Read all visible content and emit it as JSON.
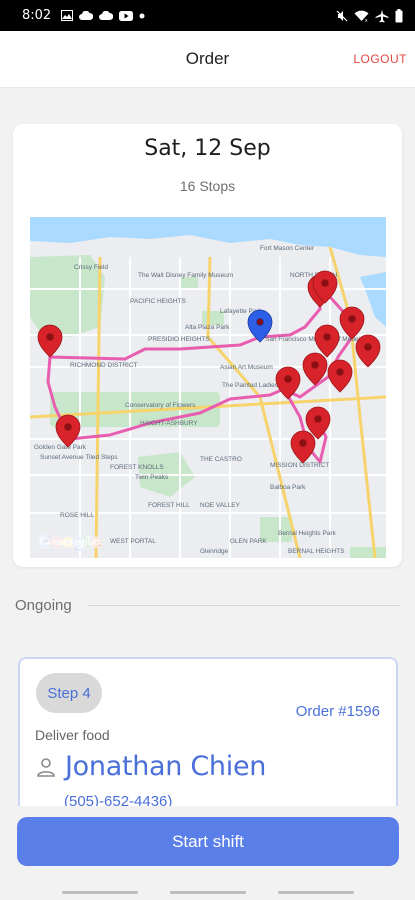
{
  "status_bar": {
    "time": "8:02",
    "left_icons": [
      "image-icon",
      "cloud-icon",
      "cloud-icon",
      "youtube-icon",
      "dot-icon"
    ],
    "right_icons": [
      "mute-icon",
      "wifi-icon",
      "airplane-icon",
      "battery-icon"
    ]
  },
  "app_bar": {
    "title": "Order",
    "logout_label": "LOGOUT"
  },
  "summary": {
    "date": "Sat, 12 Sep",
    "stops": "16 Stops",
    "map_attribution": "Google",
    "map_labels": [
      "Fort Mason Center",
      "The Walt Disney Family Museum",
      "Lafayette Park",
      "Alta Plaza Park",
      "San Francisco Museum of Modern Art",
      "Asian Art Museum",
      "The Painted Ladies",
      "Conservatory of Flowers",
      "HAIGHT-ASHBURY",
      "RICHMOND DISTRICT",
      "Golden Gate Park",
      "Sunset Avenue Tiled Steps",
      "FOREST KNOLLS",
      "Twin Peaks",
      "THE CASTRO",
      "MISSION DISTRICT",
      "Balboa Park",
      "Bernal Heights Park",
      "BERNAL HEIGHTS",
      "NOE VALLEY",
      "GLEN PARK",
      "PRESIDIO HEIGHTS",
      "Crissy Field",
      "NORTH BEACH",
      "Glenridge",
      "FOREST HILL",
      "WEST PORTAL",
      "ROSE HILL",
      "PACIFIC HEIGHTS"
    ]
  },
  "section": {
    "label": "Ongoing"
  },
  "step_card": {
    "step_label": "Step 4",
    "order_label": "Order #1596",
    "type_label": "Deliver food",
    "person_name": "Jonathan Chien",
    "phone": "(505)-652-4436)"
  },
  "actions": {
    "start_label": "Start shift"
  },
  "colors": {
    "accent": "#5b7fe8",
    "accent_text": "#4a6fd8",
    "logout": "#e0463f",
    "route": "#e85db0",
    "pin_red": "#d8232a",
    "pin_blue": "#2d5ee8"
  }
}
